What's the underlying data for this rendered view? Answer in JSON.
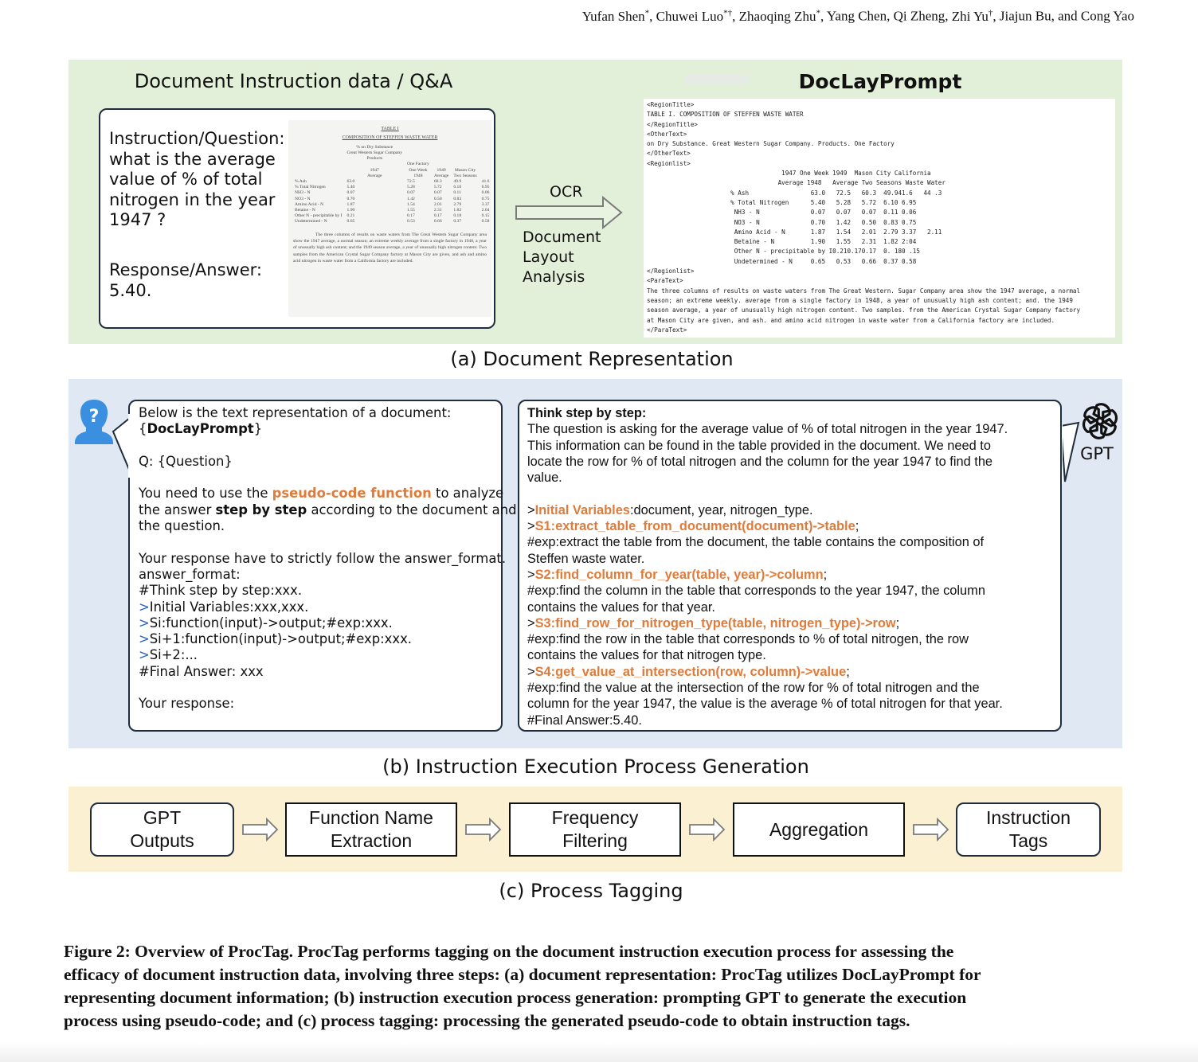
{
  "header": {
    "authors": [
      {
        "name": "Yufan Shen",
        "mark": "*"
      },
      {
        "name": "Chuwei Luo",
        "mark": "*†"
      },
      {
        "name": "Zhaoqing Zhu",
        "mark": "*"
      },
      {
        "name": "Yang Chen",
        "mark": ""
      },
      {
        "name": "Qi Zheng",
        "mark": ""
      },
      {
        "name": "Zhi Yu",
        "mark": "†"
      },
      {
        "name": "Jiajun Bu",
        "mark": ""
      },
      {
        "name": "Cong Yao",
        "mark": ""
      }
    ],
    "authors_text": "Yufan Shen*, Chuwei Luo*†, Zhaoqing Zhu*, Yang Chen, Qi Zheng, Zhi Yu†, Jiajun Bu, and Cong Yao"
  },
  "colors": {
    "section_a_bg": "#e2efd9",
    "section_b_bg": "#dfe8f3",
    "section_c_bg": "#fbf0d1",
    "highlight_orange": "#e07b39",
    "user_icon_blue": "#3a8fe0",
    "border_dark": "#1f2d3d"
  },
  "section_a": {
    "left_title": "Document Instruction data / Q&A",
    "right_title": "DocLayPrompt",
    "question_label": "Instruction/Question:",
    "question_text": "what is the average value of % of total nitrogen in the year 1947 ?",
    "answer_label": "Response/Answer:",
    "answer_text": "5.40.",
    "arrow_top_label": "OCR",
    "arrow_bottom_label": "Document Layout Analysis",
    "scan": {
      "title": "TABLE I",
      "subtitle": "COMPOSITION OF STEFFEN WASTE WATER",
      "header_rows": [
        [
          "",
          "% on Dry Substance",
          "",
          "",
          "",
          "",
          ""
        ],
        [
          "",
          "Great Western Sugar Company",
          "",
          "",
          "",
          "",
          ""
        ],
        [
          "",
          "Products",
          "",
          "",
          "",
          "",
          ""
        ],
        [
          "",
          "",
          "One Factory",
          "",
          "",
          "",
          ""
        ],
        [
          "",
          "1947",
          "One Week",
          "1949",
          "Mason City",
          "",
          "California"
        ],
        [
          "",
          "Average",
          "1948",
          "Average",
          "Two Seasons",
          "",
          "Waste Water"
        ]
      ],
      "rows": [
        [
          "% Ash",
          "63.0",
          "72.5",
          "60.3",
          "49.9",
          "41.6",
          "44.3"
        ],
        [
          "% Total Nitrogen",
          "5.40",
          "5.28",
          "5.72",
          "6.10",
          "6.95",
          ""
        ],
        [
          "NH3 - N",
          "0.07",
          "0.07",
          "0.07",
          "0.11",
          "0.06",
          ""
        ],
        [
          "NO3 - N",
          "0.70",
          "1.42",
          "0.50",
          "0.83",
          "0.75",
          ""
        ],
        [
          "Amino Acid - N",
          "1.87",
          "1.54",
          "2.01",
          "2.79",
          "3.37",
          "2.11"
        ],
        [
          "Betaine - N",
          "1.90",
          "1.55",
          "2.31",
          "1.82",
          "2.04",
          ""
        ],
        [
          "Other N - precipitable by I",
          "0.21",
          "0.17",
          "0.17",
          "0.18",
          "0.15",
          ""
        ],
        [
          "Undetermined - N",
          "0.65",
          "0.53",
          "0.66",
          "0.37",
          "0.58",
          ""
        ]
      ],
      "paragraph": "The three columns of results on waste waters from The Great Western Sugar Company area show the 1947 average, a normal season; an extreme weekly average from a single factory in 1948, a year of unusually high ash content; and the 1949 season average, a year of unusually high nitrogen content. Two samples from the American Crystal Sugar Company factory at Mason City are given, and ash and amino acid nitrogen in waste water from a California factory are included."
    },
    "doclayprompt_lines": [
      "<RegionTitle>",
      "TABLE I. COMPOSITION OF STEFFEN WASTE WATER",
      "</RegionTitle>",
      "<OtherText>",
      "on Dry Substance. Great Western Sugar Company. Products. One Factory",
      "</OtherText>",
      "<Regionlist>",
      "                                     1947 One Week 1949  Mason City California",
      "                                    Average 1948   Average Two Seasons Waste Water",
      "                       % Ash                 63.0   72.5   60.3  49.941.6   44 .3",
      "                       % Total Nitrogen      5.40   5.28   5.72  6.10 6.95",
      "                        NH3 - N              0.07   0.07   0.07  0.11 0.06",
      "                        NO3 - N              0.70   1.42   0.50  0.83 0.75",
      "                        Amino Acid - N       1.87   1.54   2.01  2.79 3.37   2.11",
      "                        Betaine - N          1.90   1.55   2.31  1.82 2:04",
      "                        Other N - precipitable by I0.210.170.17  0. 180 .15",
      "                        Undetermined - N     0.65   0.53   0.66  0.37 0.58",
      "</Regionlist>",
      "<ParaText>",
      "The three columns of results on waste waters from The Great Western. Sugar Company area show the 1947 average, a normal",
      "season; an extreme weekly. average from a single factory in 1948, a year of unusually high ash content; and. the 1949",
      "season average, a year of unusually high nitrogen content. Two samples. from the American Crystal Sugar Company factory",
      "at Mason City are given, and ash. and amino acid nitrogen in waste water from a California factory are included.",
      "</ParaText>"
    ],
    "caption": "(a) Document Representation"
  },
  "section_b": {
    "user_icon": "user-question-icon",
    "gpt_icon": "openai-logo-icon",
    "gpt_label": "GPT",
    "prompt": {
      "l1": "Below is the text representation of a document:",
      "l2_open": "{",
      "l2_bold": "DocLayPrompt",
      "l2_close": "}",
      "l3": "Q: {Question}",
      "l4_pre": "You need to use the ",
      "l4_orange": "pseudo-code function",
      "l4_post": " to analyze",
      "l5_pre": "the answer ",
      "l5_bold": "step by step",
      "l5_post": " according to the document and",
      "l6": "the question.",
      "l7": "Your response have to strictly follow the answer_format.",
      "l8": "answer_format:",
      "l9": "#Think step by step:xxx.",
      "l10_gt": ">",
      "l10": "Initial Variables:xxx,xxx.",
      "l11_gt": ">",
      "l11": "Si:function(input)->output;#exp:xxx.",
      "l12_gt": ">",
      "l12": "Si+1:function(input)->output;#exp:xxx.",
      "l13_gt": ">",
      "l13": "Si+2:...",
      "l14": "#Final Answer: xxx",
      "l15": "Your response:"
    },
    "response": {
      "heading": "Think step by step:",
      "p1": "The question is asking for the average value of % of total nitrogen in the year 1947.",
      "p2": "This information can be found in the table provided in the document. We need to",
      "p3": "locate the row for % of total nitrogen and the column for the year 1947 to find the",
      "p4": "value.",
      "iv_gt": ">",
      "iv_label": "Initial Variables",
      "iv_rest": ":document, year, nitrogen_type.",
      "s1_gt": ">",
      "s1": "S1:extract_table_from_document(document)->table",
      "s1_end": ";",
      "s1_exp1": "#exp:extract the table from the document, the table contains the composition of",
      "s1_exp2": "Steffen waste water.",
      "s2_gt": ">",
      "s2": "S2:find_column_for_year(table, year)->column",
      "s2_end": ";",
      "s2_exp1": "#exp:find the column in the table that corresponds to the year 1947, the column",
      "s2_exp2": "contains the values for that year.",
      "s3_gt": ">",
      "s3": "S3:find_row_for_nitrogen_type(table, nitrogen_type)->row",
      "s3_end": ";",
      "s3_exp1": "#exp:find the row in the table that corresponds to % of total nitrogen, the row",
      "s3_exp2": "contains the values for that nitrogen type.",
      "s4_gt": ">",
      "s4": "S4:get_value_at_intersection(row, column)->value",
      "s4_end": ";",
      "s4_exp1": "#exp:find the value at the intersection of the row for % of total nitrogen and the",
      "s4_exp2": "column for the year 1947, the value is the average % of total nitrogen for that year.",
      "final": "#Final Answer:5.40."
    },
    "caption": "(b) Instruction Execution Process Generation"
  },
  "section_c": {
    "steps": [
      {
        "label_1": "GPT",
        "label_2": "Outputs"
      },
      {
        "label_1": "Function Name",
        "label_2": "Extraction"
      },
      {
        "label_1": "Frequency",
        "label_2": "Filtering"
      },
      {
        "label_1": "Aggregation",
        "label_2": ""
      },
      {
        "label_1": "Instruction",
        "label_2": "Tags"
      }
    ],
    "caption": "(c) Process Tagging"
  },
  "figure_caption": {
    "l1": "Figure 2: Overview of ProcTag. ProcTag performs tagging on the document instruction execution process for assessing the",
    "l2": "efficacy of document instruction data, involving three steps: (a) document representation: ProcTag utilizes DocLayPrompt for",
    "l3": "representing document information; (b) instruction execution process generation: prompting GPT to generate the execution",
    "l4": "process using pseudo-code; and (c) process tagging: processing the generated pseudo-code to obtain instruction tags."
  }
}
